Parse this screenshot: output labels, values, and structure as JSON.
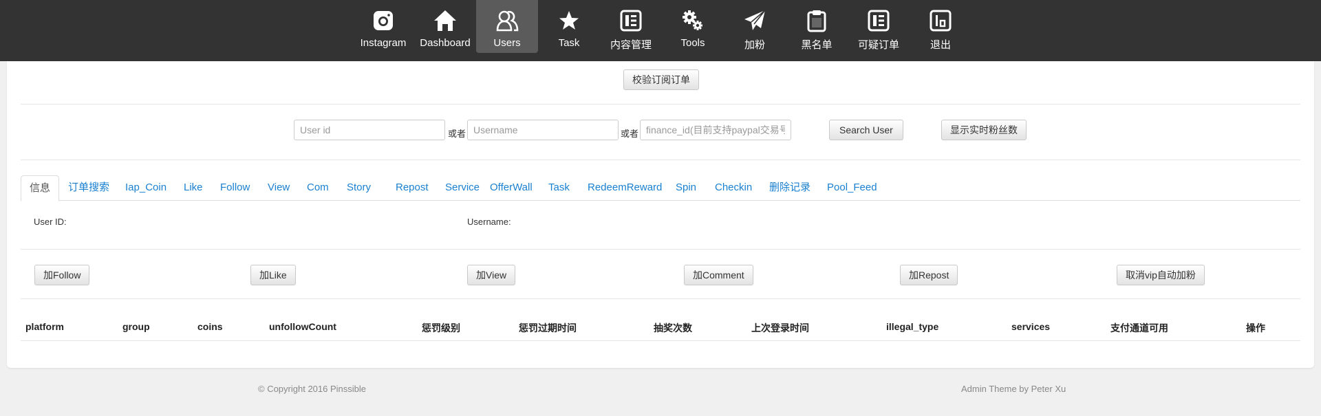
{
  "nav": {
    "items": [
      {
        "label": "Instagram",
        "icon": "instagram-icon"
      },
      {
        "label": "Dashboard",
        "icon": "home-icon"
      },
      {
        "label": "Users",
        "icon": "users-icon",
        "active": true
      },
      {
        "label": "Task",
        "icon": "star-icon"
      },
      {
        "label": "内容管理",
        "icon": "content-icon"
      },
      {
        "label": "Tools",
        "icon": "gears-icon"
      },
      {
        "label": "加粉",
        "icon": "send-icon"
      },
      {
        "label": "黑名单",
        "icon": "clipboard-icon"
      },
      {
        "label": "可疑订单",
        "icon": "order-icon"
      },
      {
        "label": "退出",
        "icon": "logout-icon"
      }
    ]
  },
  "verify_button": "校验订阅订单",
  "search": {
    "userid_placeholder": "User id",
    "or1": "或者",
    "username_placeholder": "Username",
    "or2": "或者",
    "finance_placeholder": "finance_id(目前支持paypal交易号",
    "search_button": "Search User",
    "realtime_button": "显示实时粉丝数"
  },
  "tabs": [
    "信息",
    "订单搜索",
    "Iap_Coin",
    "Like",
    "Follow",
    "View",
    "Com",
    "Story",
    "Repost",
    "Service",
    "OfferWall",
    "Task",
    "RedeemReward",
    "Spin",
    "Checkin",
    "删除记录",
    "Pool_Feed"
  ],
  "info": {
    "user_id_label": "User ID:",
    "username_label": "Username:"
  },
  "actions": [
    "加Follow",
    "加Like",
    "加View",
    "加Comment",
    "加Repost",
    "取消vip自动加粉"
  ],
  "table": {
    "headers": [
      "platform",
      "group",
      "coins",
      "unfollowCount",
      "惩罚级别",
      "惩罚过期时间",
      "抽奖次数",
      "上次登录时间",
      "illegal_type",
      "services",
      "支付通道可用",
      "操作"
    ]
  },
  "footer": {
    "copyright": "© Copyright 2016 Pinssible",
    "theme": "Admin Theme by Peter Xu"
  },
  "colors": {
    "nav_bg": "#333333",
    "nav_active": "#5b5b5b",
    "link": "#1a80d0"
  }
}
